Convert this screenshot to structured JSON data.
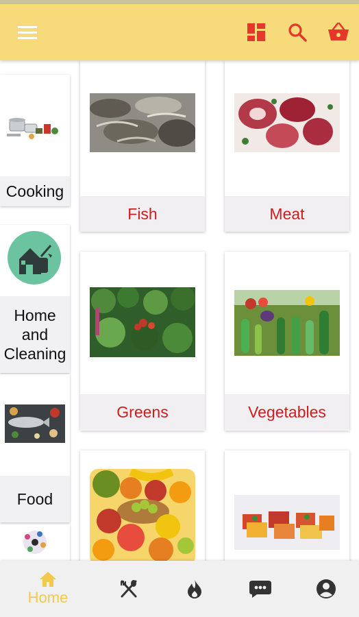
{
  "app_bar": {
    "menu_icon": "menu-icon",
    "actions": [
      "dashboard-icon",
      "search-icon",
      "basket-icon"
    ],
    "colors": {
      "background": "#f7db7b",
      "icon": "#e5372b"
    }
  },
  "sidebar": {
    "items": [
      {
        "label": "Cooking",
        "icon": "cooking-image"
      },
      {
        "label": "Home\nand\nCleaning",
        "icon": "home-cleaning-image"
      },
      {
        "label": "Food",
        "icon": "food-image"
      },
      {
        "label": "",
        "icon": "beauty-image"
      }
    ]
  },
  "categories": [
    {
      "label": "Fish",
      "image": "fish-image"
    },
    {
      "label": "Meat",
      "image": "meat-image"
    },
    {
      "label": "Greens",
      "image": "greens-image"
    },
    {
      "label": "Vegetables",
      "image": "vegetables-image"
    },
    {
      "label": "",
      "image": "fruits-image"
    },
    {
      "label": "",
      "image": "packaged-food-image"
    }
  ],
  "bottom_nav": {
    "items": [
      {
        "label": "Home",
        "icon": "home-icon",
        "active": true
      },
      {
        "icon": "restaurant-icon"
      },
      {
        "icon": "flame-icon"
      },
      {
        "icon": "chat-icon"
      },
      {
        "icon": "account-icon"
      }
    ],
    "colors": {
      "active": "#f2c94c",
      "inactive": "#333333"
    }
  }
}
